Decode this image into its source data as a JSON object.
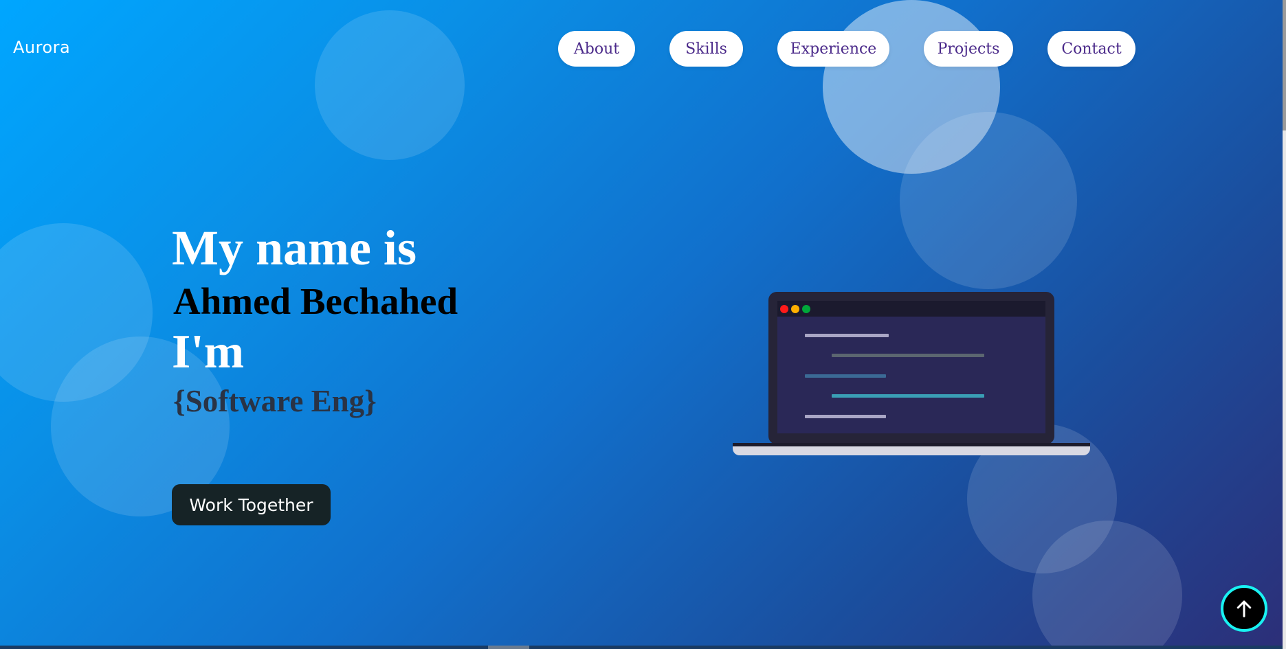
{
  "header": {
    "logo": "Aurora",
    "nav": [
      {
        "label": "About"
      },
      {
        "label": "Skills"
      },
      {
        "label": "Experience"
      },
      {
        "label": "Projects"
      },
      {
        "label": "Contact"
      }
    ]
  },
  "hero": {
    "line1": "My name is",
    "name": "Ahmed Bechahed",
    "line3": "I'm",
    "role": "{Software Eng}",
    "cta_label": "Work Together"
  },
  "illustration": {
    "icon": "laptop-code-icon"
  },
  "scroll_top": {
    "icon": "arrow-up-icon"
  },
  "colors": {
    "background_start": "#00a6ff",
    "background_end": "#2c2f78",
    "nav_text": "#4b2a8a",
    "cta_background": "#162326",
    "scroll_ring": "#19f2f2"
  }
}
